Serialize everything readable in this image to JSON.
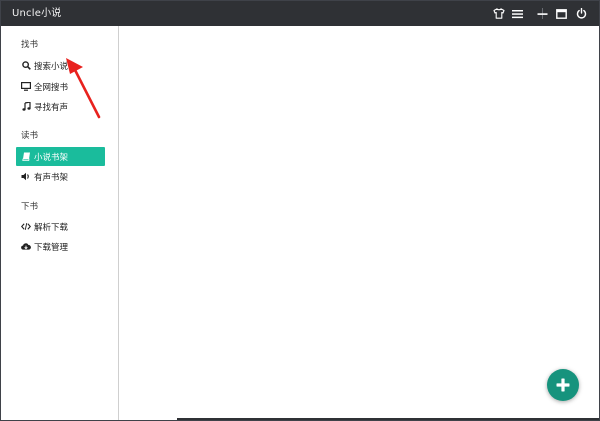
{
  "window": {
    "title": "Uncle小说"
  },
  "titlebar": {
    "icons": [
      "shirt-icon",
      "menu-icon",
      "minimize-icon",
      "maximize-icon",
      "power-icon"
    ]
  },
  "sidebar": {
    "sections": [
      {
        "title": "找书",
        "items": [
          {
            "label": "搜索小说",
            "icon": "search-icon",
            "active": false
          },
          {
            "label": "全网搜书",
            "icon": "monitor-icon",
            "active": false
          },
          {
            "label": "寻找有声",
            "icon": "music-icon",
            "active": false
          }
        ]
      },
      {
        "title": "读书",
        "items": [
          {
            "label": "小说书架",
            "icon": "book-icon",
            "active": true
          },
          {
            "label": "有声书架",
            "icon": "speaker-icon",
            "active": false
          }
        ]
      },
      {
        "title": "下书",
        "items": [
          {
            "label": "解析下载",
            "icon": "code-icon",
            "active": false
          },
          {
            "label": "下载管理",
            "icon": "cloud-download-icon",
            "active": false
          }
        ]
      }
    ]
  },
  "fab": {
    "icon": "plus-icon"
  },
  "colors": {
    "titlebar": "#2f3135",
    "accent": "#1abc9c",
    "fab": "#16937d",
    "arrow": "#e8221e"
  }
}
